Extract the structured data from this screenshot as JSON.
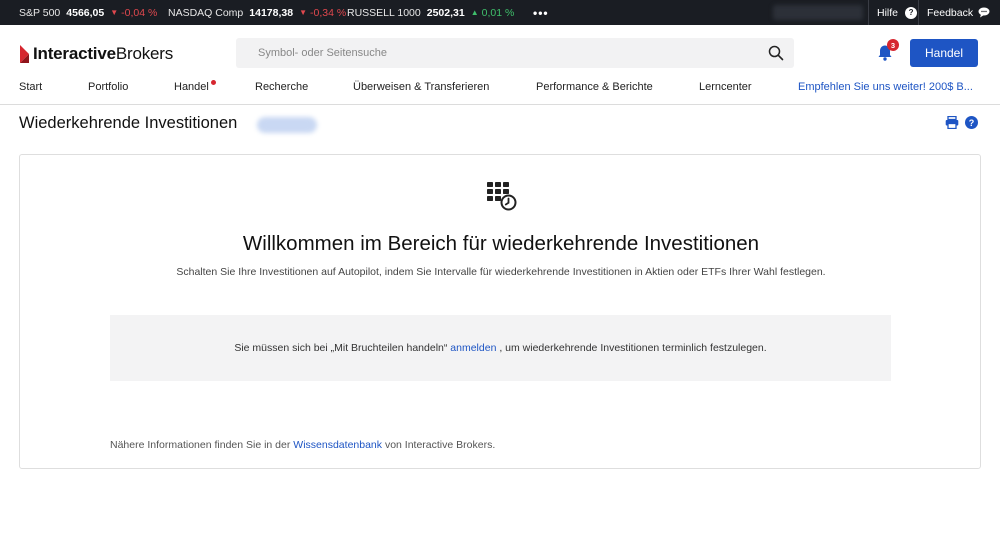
{
  "ticker": [
    {
      "name": "S&P 500",
      "price": "4566,05",
      "change": "-0,04 %",
      "direction": "down"
    },
    {
      "name": "NASDAQ Comp",
      "price": "14178,38",
      "change": "-0,34 %",
      "direction": "down"
    },
    {
      "name": "RUSSELL 1000",
      "price": "2502,31",
      "change": "0,01 %",
      "direction": "up"
    }
  ],
  "ticker_more": "•••",
  "top_links": {
    "help": "Hilfe",
    "help_icon": "?",
    "feedback": "Feedback"
  },
  "brand": {
    "bold": "Interactive",
    "light": "Brokers"
  },
  "search": {
    "placeholder": "Symbol- oder Seitensuche"
  },
  "notifications": {
    "count": "3"
  },
  "trade_button": "Handel",
  "nav": [
    "Start",
    "Portfolio",
    "Handel",
    "Recherche",
    "Überweisen & Transferieren",
    "Performance & Berichte",
    "Lerncenter",
    "Empfehlen Sie uns weiter! 200$ B..."
  ],
  "page": {
    "title": "Wiederkehrende Investitionen",
    "help_icon": "?"
  },
  "card": {
    "heading": "Willkommen im Bereich für wiederkehrende Investitionen",
    "subtitle": "Schalten Sie Ihre Investitionen auf Autopilot, indem Sie Intervalle für wiederkehrende Investitionen in Aktien oder ETFs Ihrer Wahl festlegen.",
    "notice_pre": "Sie müssen sich bei „Mit Bruchteilen handeln“",
    "notice_link": "anmelden",
    "notice_post": ", um wiederkehrende Investitionen terminlich festzulegen.",
    "info_pre": "Nähere Informationen finden Sie in der",
    "info_link": "Wissensdatenbank",
    "info_post": "von Interactive Brokers."
  },
  "colors": {
    "accent": "#1e55c4",
    "negative": "#e0484e",
    "positive": "#3fbf6b",
    "brand_red": "#d6262f",
    "ticker_bg": "#1a1d23"
  }
}
